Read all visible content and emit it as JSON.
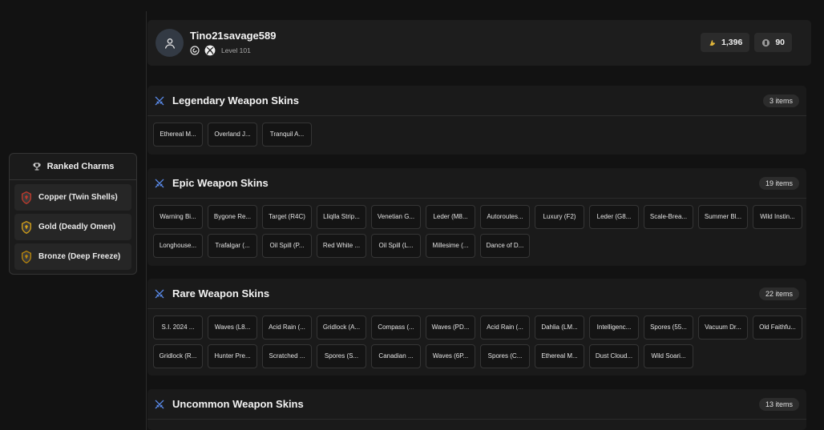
{
  "profile": {
    "username": "Tino21savage589",
    "level": "Level 101",
    "credits": "1,396",
    "renown": "90"
  },
  "charms": {
    "title": "Ranked Charms",
    "items": [
      {
        "label": "Copper (Twin Shells)",
        "color": "#c0392b"
      },
      {
        "label": "Gold (Deadly Omen)",
        "color": "#d4a017"
      },
      {
        "label": "Bronze (Deep Freeze)",
        "color": "#b8860b"
      }
    ]
  },
  "sections": [
    {
      "title": "Legendary Weapon Skins",
      "count": "3 items",
      "items": [
        "Ethereal M...",
        "Overland J...",
        "Tranquil A..."
      ]
    },
    {
      "title": "Epic Weapon Skins",
      "count": "19 items",
      "items": [
        "Warning Bi...",
        "Bygone Re...",
        "Target (R4C)",
        "Lliqlla Strip...",
        "Venetian G...",
        "Leder (M8...",
        "Autoroutes...",
        "Luxury (F2)",
        "Leder (G8...",
        "Scale-Brea...",
        "Summer Bl...",
        "Wild Instin...",
        "Longhouse...",
        "Trafalgar (...",
        "Oil Spill (P...",
        "Red White ...",
        "Oil Spill (L...",
        "Millesime (...",
        "Dance of D..."
      ]
    },
    {
      "title": "Rare Weapon Skins",
      "count": "22 items",
      "items": [
        "S.I. 2024 ...",
        "Waves (L8...",
        "Acid Rain (...",
        "Gridlock (A...",
        "Compass (...",
        "Waves (PD...",
        "Acid Rain (...",
        "Dahlia (LM...",
        "Intelligenc...",
        "Spores (55...",
        "Vacuum Dr...",
        "Old Faithfu...",
        "Gridlock (R...",
        "Hunter Pre...",
        "Scratched ...",
        "Spores (S...",
        "Canadian ...",
        "Waves (6P...",
        "Spores (C...",
        "Ethereal M...",
        "Dust Cloud...",
        "Wild Soari..."
      ]
    },
    {
      "title": "Uncommon Weapon Skins",
      "count": "13 items",
      "items": []
    }
  ],
  "accent": "#5b8def"
}
